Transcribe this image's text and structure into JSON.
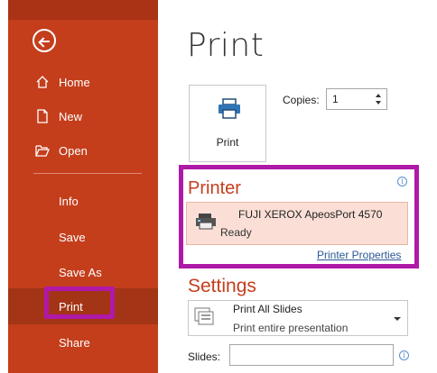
{
  "sidebar": {
    "items": [
      {
        "label": "Home",
        "icon": "home-icon"
      },
      {
        "label": "New",
        "icon": "new-document-icon"
      },
      {
        "label": "Open",
        "icon": "open-folder-icon"
      },
      {
        "label": "Info"
      },
      {
        "label": "Save"
      },
      {
        "label": "Save As"
      },
      {
        "label": "Print"
      },
      {
        "label": "Share"
      }
    ],
    "active": "Print",
    "background_color": "#c43e1c",
    "highlight_color": "#b019a8"
  },
  "main": {
    "title": "Print",
    "print_button_label": "Print",
    "copies_label": "Copies:",
    "copies_value": "1",
    "printer": {
      "section_title": "Printer",
      "name": "FUJI XEROX ApeosPort 4570",
      "status": "Ready",
      "properties_link": "Printer Properties"
    },
    "settings": {
      "section_title": "Settings",
      "dropdown_main": "Print All Slides",
      "dropdown_sub": "Print entire presentation",
      "slides_label": "Slides:",
      "slides_value": ""
    },
    "info_glyph": "i",
    "accent_color": "#c43e1c",
    "link_color": "#2b5797"
  }
}
